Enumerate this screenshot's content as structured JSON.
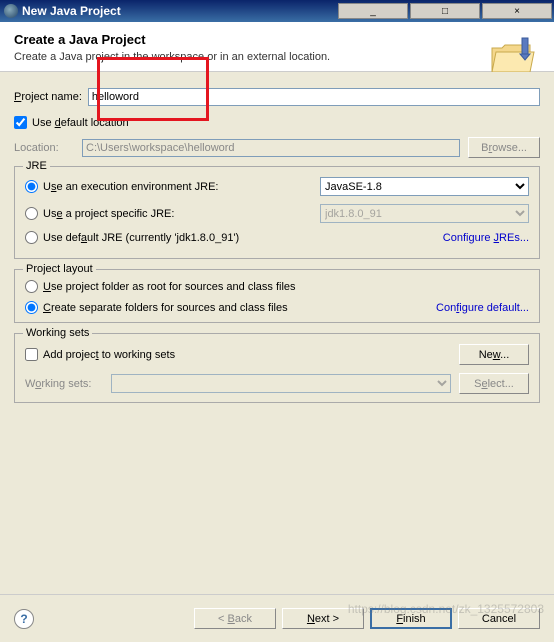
{
  "window": {
    "title": "New Java Project",
    "minimize": "_",
    "maximize": "□",
    "close": "×"
  },
  "header": {
    "title": "Create a Java Project",
    "subtitle": "Create a Java project in the workspace or in an external location."
  },
  "project": {
    "name_label": "Project name:",
    "name_value": "helloword",
    "use_default_label": "Use default location",
    "location_label": "Location:",
    "location_value": "C:\\Users\\workspace\\helloword",
    "browse_label": "Browse..."
  },
  "jre": {
    "legend": "JRE",
    "exec_env_label": "Use an execution environment JRE:",
    "exec_env_value": "JavaSE-1.8",
    "project_specific_label": "Use a project specific JRE:",
    "project_specific_value": "jdk1.8.0_91",
    "default_label": "Use default JRE (currently 'jdk1.8.0_91')",
    "configure_link": "Configure JREs..."
  },
  "layout": {
    "legend": "Project layout",
    "root_label": "Use project folder as root for sources and class files",
    "separate_label": "Create separate folders for sources and class files",
    "configure_link": "Configure default..."
  },
  "working_sets": {
    "legend": "Working sets",
    "add_label": "Add project to working sets",
    "new_label": "New...",
    "sets_label": "Working sets:",
    "select_label": "Select..."
  },
  "footer": {
    "back": "< Back",
    "next": "Next >",
    "finish": "Finish",
    "cancel": "Cancel",
    "help": "?"
  },
  "watermark": "https://blog.csdn.net/zk_1325572803"
}
